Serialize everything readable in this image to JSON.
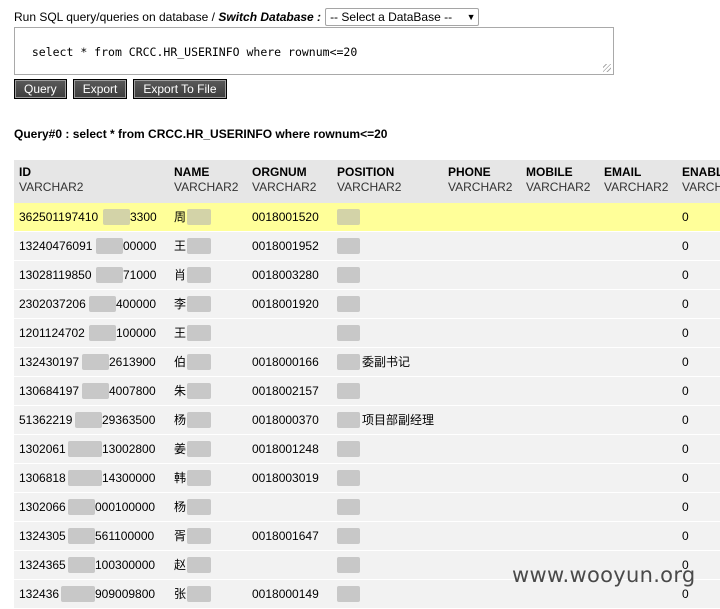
{
  "top": {
    "label_prefix": "Run SQL query/queries on database / ",
    "label_switch": "Switch Database :",
    "db_select_value": "-- Select a DataBase --"
  },
  "sql_text": "select * from CRCC.HR_USERINFO where rownum<=20",
  "buttons": {
    "query": "Query",
    "export": "Export",
    "export_file": "Export To File"
  },
  "query_title": "Query#0 : select * from CRCC.HR_USERINFO where rownum<=20",
  "columns": [
    {
      "name": "ID",
      "type": "VARCHAR2"
    },
    {
      "name": "NAME",
      "type": "VARCHAR2"
    },
    {
      "name": "ORGNUM",
      "type": "VARCHAR2"
    },
    {
      "name": "POSITION",
      "type": "VARCHAR2"
    },
    {
      "name": "PHONE",
      "type": "VARCHAR2"
    },
    {
      "name": "MOBILE",
      "type": "VARCHAR2"
    },
    {
      "name": "EMAIL",
      "type": "VARCHAR2"
    },
    {
      "name": "ENABL",
      "type": "VARCH"
    }
  ],
  "rows": [
    {
      "id_a": "362501197410",
      "id_b": "3300",
      "name": "周",
      "orgnum": "0018001520",
      "position": "",
      "enabled": "0"
    },
    {
      "id_a": "13240476091",
      "id_b": "00000",
      "name": "王",
      "orgnum": "0018001952",
      "position": "",
      "enabled": "0"
    },
    {
      "id_a": "13028119850",
      "id_b": "71000",
      "name": "肖",
      "orgnum": "0018003280",
      "position": "",
      "enabled": "0"
    },
    {
      "id_a": "2302037206",
      "id_b": "400000",
      "name": "李",
      "orgnum": "0018001920",
      "position": "",
      "enabled": "0"
    },
    {
      "id_a": "1201124702",
      "id_b": "100000",
      "name": "王",
      "orgnum": "",
      "position": "",
      "enabled": "0"
    },
    {
      "id_a": "132430197",
      "id_b": "2613900",
      "name": "伯",
      "orgnum": "0018000166",
      "position": "委副书记",
      "enabled": "0"
    },
    {
      "id_a": "130684197",
      "id_b": "4007800",
      "name": "朱",
      "orgnum": "0018002157",
      "position": "",
      "enabled": "0"
    },
    {
      "id_a": "51362219",
      "id_b": "29363500",
      "name": "杨",
      "orgnum": "0018000370",
      "position": "项目部副经理",
      "enabled": "0"
    },
    {
      "id_a": "1302061",
      "id_b": "13002800",
      "name": "姜",
      "orgnum": "0018001248",
      "position": "",
      "enabled": "0"
    },
    {
      "id_a": "1306818",
      "id_b": "14300000",
      "name": "韩",
      "orgnum": "0018003019",
      "position": "",
      "enabled": "0"
    },
    {
      "id_a": "1302066",
      "id_b": "000100000",
      "name": "杨",
      "orgnum": "",
      "position": "",
      "enabled": "0"
    },
    {
      "id_a": "1324305",
      "id_b": "561100000",
      "name": "胥",
      "orgnum": "0018001647",
      "position": "",
      "enabled": "0"
    },
    {
      "id_a": "1324365",
      "id_b": "100300000",
      "name": "赵",
      "orgnum": "",
      "position": "",
      "enabled": "0"
    },
    {
      "id_a": "132436",
      "id_b": "909009800",
      "name": "张",
      "orgnum": "0018000149",
      "position": "",
      "enabled": "0"
    }
  ],
  "watermark": "www.wooyun.org"
}
